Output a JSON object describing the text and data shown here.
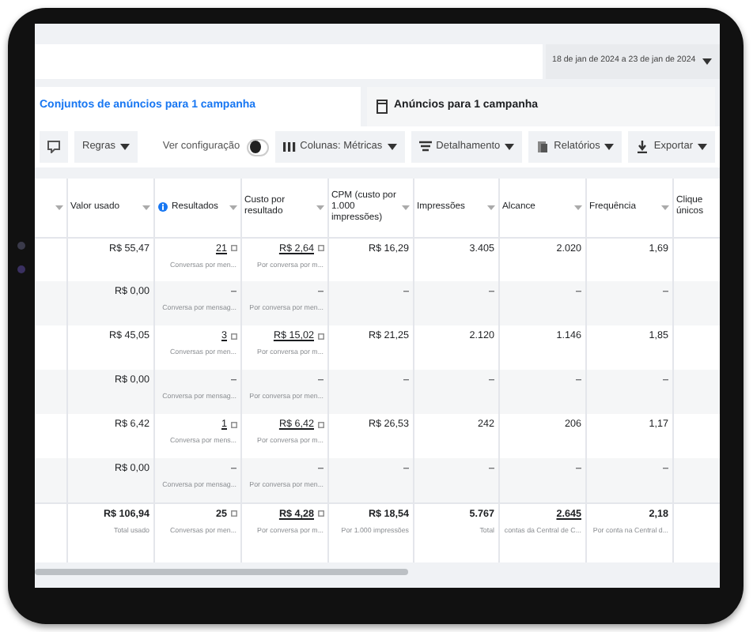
{
  "date_range": {
    "label": "18 de jan de 2024 a 23 de jan de 2024"
  },
  "tabs": [
    {
      "label": "Conjuntos de anúncios para 1 campanha",
      "selected": true
    },
    {
      "label": "Anúncios para 1 campanha",
      "selected": false
    }
  ],
  "toolbar": {
    "rules_button": "Regras",
    "view_setting": {
      "label": "Ver configuração",
      "on": false
    },
    "buttons": [
      {
        "label": "Colunas: Métricas",
        "kind": "columns"
      },
      {
        "label": "Detalhamento",
        "kind": "breakdown"
      },
      {
        "label": "Relatórios",
        "kind": "reports"
      },
      {
        "label": "Exportar",
        "kind": "export"
      }
    ]
  },
  "table": {
    "columns": [
      {
        "label": "Valor usado",
        "info": false,
        "sortable": true
      },
      {
        "label": "Resultados",
        "info": true,
        "sortable": true
      },
      {
        "label": "Custo por resultado",
        "info": false,
        "sortable": true
      },
      {
        "label": "CPM (custo por 1.000 impressões)",
        "info": false,
        "sortable": true
      },
      {
        "label": "Impressões",
        "info": false,
        "sortable": true
      },
      {
        "label": "Alcance",
        "info": false,
        "sortable": true
      },
      {
        "label": "Frequência",
        "info": false,
        "sortable": true
      },
      {
        "label": "Clique únicos",
        "info": false,
        "sortable": false
      }
    ],
    "rows": [
      {
        "cells": [
          {
            "value": "R$ 55,47",
            "kind": "plain"
          },
          {
            "value": "21",
            "sub": "Conversas por men...",
            "kind": "linked"
          },
          {
            "value": "R$ 2,64",
            "sub": "Por conversa por m...",
            "kind": "linked"
          },
          {
            "value": "R$ 16,29",
            "kind": "plain"
          },
          {
            "value": "3.405",
            "kind": "plain"
          },
          {
            "value": "2.020",
            "kind": "plain"
          },
          {
            "value": "1,69",
            "kind": "plain"
          }
        ]
      },
      {
        "cells": [
          {
            "value": "R$ 0,00",
            "kind": "plain"
          },
          {
            "value": "–",
            "sub": "Conversa por mensag...",
            "kind": "plain"
          },
          {
            "value": "–",
            "sub": "Por conversa por men...",
            "kind": "plain"
          },
          {
            "value": "–",
            "kind": "plain"
          },
          {
            "value": "–",
            "kind": "plain"
          },
          {
            "value": "–",
            "kind": "plain"
          },
          {
            "value": "–",
            "kind": "plain"
          }
        ]
      },
      {
        "cells": [
          {
            "value": "R$ 45,05",
            "kind": "plain"
          },
          {
            "value": "3",
            "sub": "Conversas por men...",
            "kind": "linked"
          },
          {
            "value": "R$ 15,02",
            "sub": "Por conversa por m...",
            "kind": "linked"
          },
          {
            "value": "R$ 21,25",
            "kind": "plain"
          },
          {
            "value": "2.120",
            "kind": "plain"
          },
          {
            "value": "1.146",
            "kind": "plain"
          },
          {
            "value": "1,85",
            "kind": "plain"
          }
        ]
      },
      {
        "cells": [
          {
            "value": "R$ 0,00",
            "kind": "plain"
          },
          {
            "value": "–",
            "sub": "Conversa por mensag...",
            "kind": "plain"
          },
          {
            "value": "–",
            "sub": "Por conversa por men...",
            "kind": "plain"
          },
          {
            "value": "–",
            "kind": "plain"
          },
          {
            "value": "–",
            "kind": "plain"
          },
          {
            "value": "–",
            "kind": "plain"
          },
          {
            "value": "–",
            "kind": "plain"
          }
        ]
      },
      {
        "cells": [
          {
            "value": "R$ 6,42",
            "kind": "plain"
          },
          {
            "value": "1",
            "sub": "Conversa por mens...",
            "kind": "linked"
          },
          {
            "value": "R$ 6,42",
            "sub": "Por conversa por m...",
            "kind": "linked"
          },
          {
            "value": "R$ 26,53",
            "kind": "plain"
          },
          {
            "value": "242",
            "kind": "plain"
          },
          {
            "value": "206",
            "kind": "plain"
          },
          {
            "value": "1,17",
            "kind": "plain"
          }
        ]
      },
      {
        "cells": [
          {
            "value": "R$ 0,00",
            "kind": "plain"
          },
          {
            "value": "–",
            "sub": "Conversa por mensag...",
            "kind": "plain"
          },
          {
            "value": "–",
            "sub": "Por conversa por men...",
            "kind": "plain"
          },
          {
            "value": "–",
            "kind": "plain"
          },
          {
            "value": "–",
            "kind": "plain"
          },
          {
            "value": "–",
            "kind": "plain"
          },
          {
            "value": "–",
            "kind": "plain"
          }
        ]
      }
    ],
    "totals": {
      "cells": [
        {
          "value": "R$ 106,94",
          "sub": "Total usado",
          "kind": "plain"
        },
        {
          "value": "25",
          "sub": "Conversas por men...",
          "kind": "noted"
        },
        {
          "value": "R$ 4,28",
          "sub": "Por conversa por m...",
          "kind": "linked"
        },
        {
          "value": "R$ 18,54",
          "sub": "Por 1.000 impressões",
          "kind": "plain"
        },
        {
          "value": "5.767",
          "sub": "Total",
          "kind": "plain"
        },
        {
          "value": "2.645",
          "sub": "contas da Central de C...",
          "kind": "underlined"
        },
        {
          "value": "2,18",
          "sub": "Por conta na Central d...",
          "kind": "plain"
        }
      ]
    }
  }
}
